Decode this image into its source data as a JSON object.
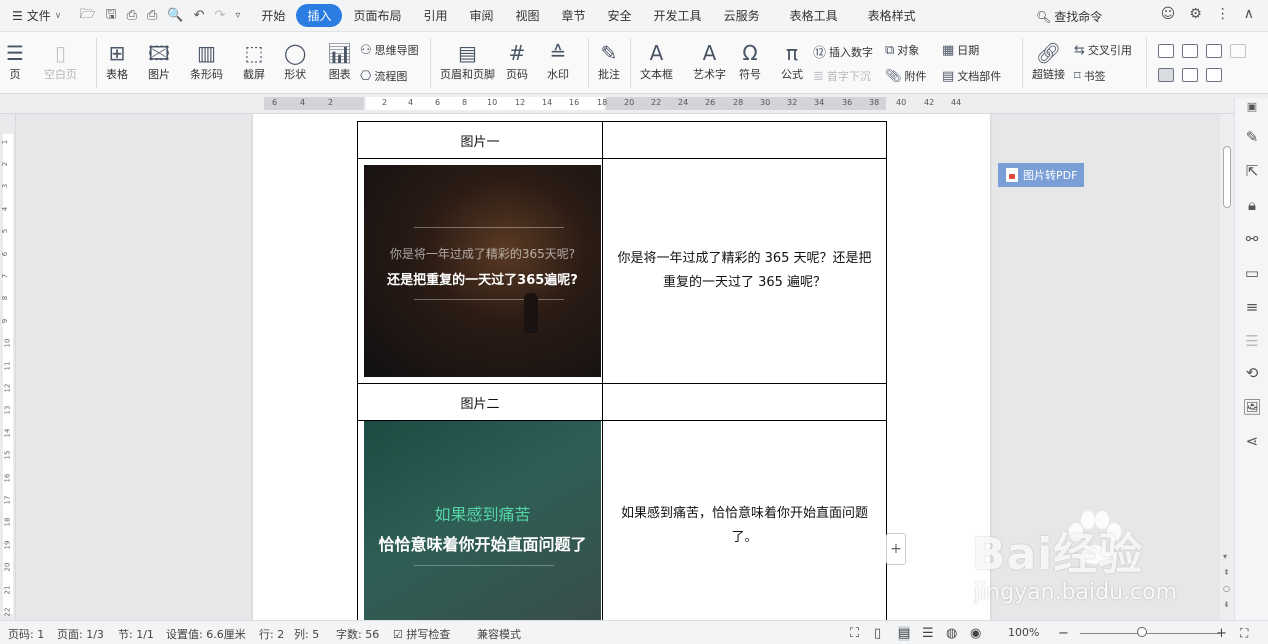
{
  "menubar": {
    "file_label": "文件",
    "tabs": [
      {
        "label": "开始",
        "active": false
      },
      {
        "label": "插入",
        "active": true
      },
      {
        "label": "页面布局",
        "active": false
      },
      {
        "label": "引用",
        "active": false
      },
      {
        "label": "审阅",
        "active": false
      },
      {
        "label": "视图",
        "active": false
      },
      {
        "label": "章节",
        "active": false
      },
      {
        "label": "安全",
        "active": false
      },
      {
        "label": "开发工具",
        "active": false
      },
      {
        "label": "云服务",
        "active": false
      },
      {
        "label": "表格工具",
        "active": false
      },
      {
        "label": "表格样式",
        "active": false
      }
    ],
    "search_label": "查找命令"
  },
  "ribbon": {
    "page_label": "页",
    "blank_page_label": "空白页",
    "table_label": "表格",
    "picture_label": "图片",
    "barcode_label": "条形码",
    "screenshot_label": "截屏",
    "shape_label": "形状",
    "chart_label": "图表",
    "mindmap_label": "思维导图",
    "flowchart_label": "流程图",
    "header_footer_label": "页眉和页脚",
    "page_number_label": "页码",
    "watermark_label": "水印",
    "comment_label": "批注",
    "textbox_label": "文本框",
    "wordart_label": "艺术字",
    "symbol_label": "符号",
    "formula_label": "公式",
    "insert_number_label": "插入数字",
    "dropcap_label": "首字下沉",
    "object_label": "对象",
    "attachment_label": "附件",
    "date_label": "日期",
    "doc_parts_label": "文档部件",
    "hyperlink_label": "超链接",
    "crossref_label": "交叉引用",
    "bookmark_label": "书签"
  },
  "ruler": {
    "numbers": [
      "6",
      "4",
      "2",
      "2",
      "4",
      "6",
      "8",
      "10",
      "12",
      "14",
      "16",
      "18",
      "20",
      "22",
      "24",
      "26",
      "28",
      "30",
      "32",
      "34",
      "36",
      "38",
      "40",
      "42",
      "44"
    ]
  },
  "vruler": {
    "numbers": [
      "1",
      "2",
      "3",
      "4",
      "5",
      "6",
      "7",
      "8",
      "9",
      "10",
      "11",
      "12",
      "13",
      "14",
      "15",
      "16",
      "17",
      "18",
      "19",
      "20",
      "21",
      "22"
    ]
  },
  "document": {
    "caption1": "图片一",
    "caption2": "图片二",
    "img1_line1": "你是将一年过成了精彩的365天呢?",
    "img1_line2": "还是把重复的一天过了365遍呢?",
    "img2_line1": "如果感到痛苦",
    "img2_line2": "恰恰意味着你开始直面问题了",
    "cell1_text": "你是将一年过成了精彩的 365 天呢？还是把重复的一天过了 365 遍呢？",
    "cell2_text": "如果感到痛苦，恰恰意味着你开始直面问题了。"
  },
  "pdf_button_label": "图片转PDF",
  "statusbar": {
    "page_no": "页码: 1",
    "page_of": "页面: 1/3",
    "section": "节: 1/1",
    "setting": "设置值: 6.6厘米",
    "row": "行: 2",
    "col": "列: 5",
    "word_count": "字数: 56",
    "spell_check": "拼写检查",
    "compat_mode": "兼容模式",
    "zoom": "100%"
  },
  "watermark": {
    "brand": "Bai经验",
    "url": "jingyan.baidu.com"
  },
  "colors": {
    "accent": "#2b7de1",
    "pdf_button": "#7a9fd6",
    "img2_highlight": "#55d4a6"
  }
}
